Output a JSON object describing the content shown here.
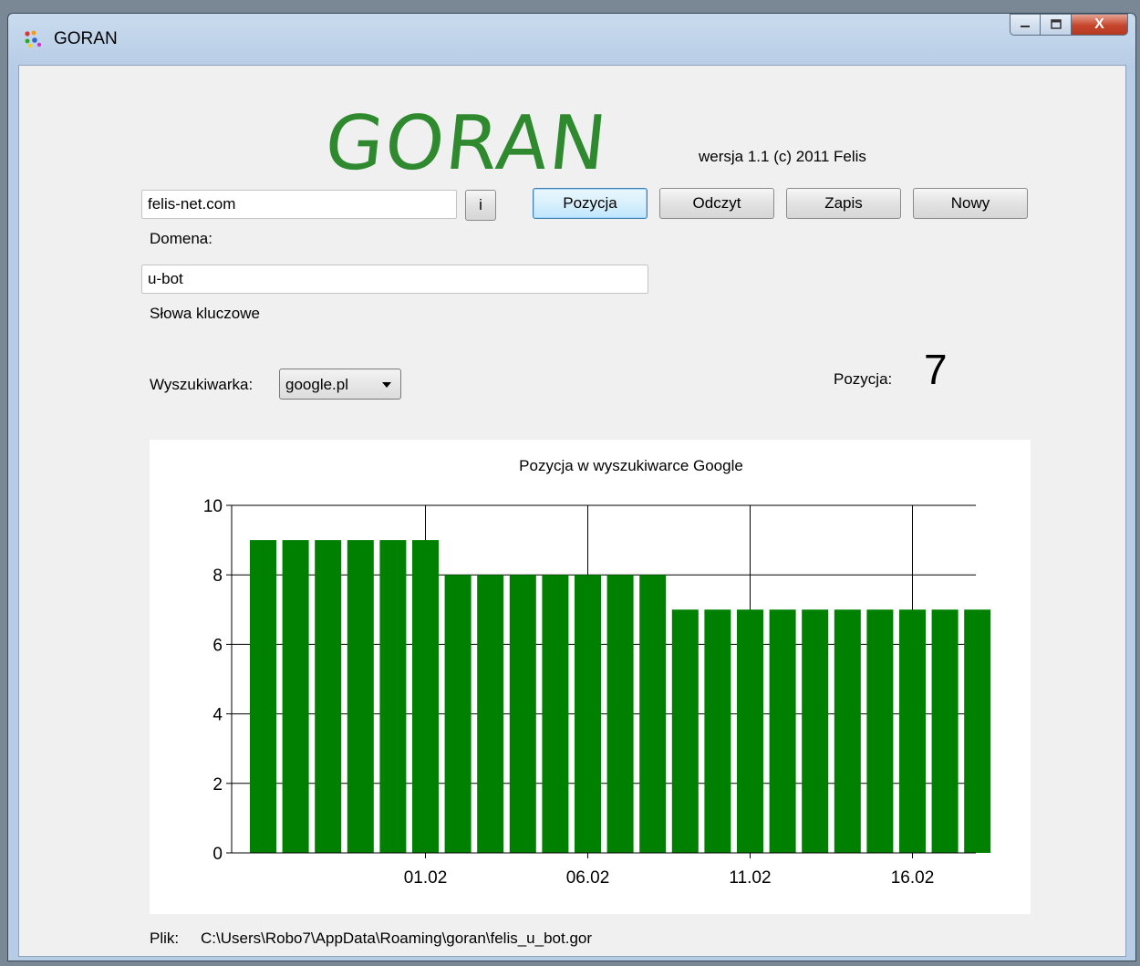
{
  "window": {
    "title": "GORAN",
    "buttons": {
      "minimize": "–",
      "maximize": "□",
      "close": "X"
    }
  },
  "header": {
    "logo_text": "GORAN",
    "version": "wersja 1.1   (c) 2011 Felis"
  },
  "form": {
    "domain_value": "felis-net.com",
    "info_button": "i",
    "domain_label": "Domena:",
    "keywords_value": "u-bot",
    "keywords_label": "Słowa kluczowe",
    "engine_label": "Wyszukiwarka:",
    "engine_selected": "google.pl",
    "position_label": "Pozycja:",
    "position_value": "7"
  },
  "toolbar": {
    "pozycja": "Pozycja",
    "odczyt": "Odczyt",
    "zapis": "Zapis",
    "nowy": "Nowy"
  },
  "footer": {
    "file_label": "Plik:",
    "file_path": "C:\\Users\\Robo7\\AppData\\Roaming\\goran\\felis_u_bot.gor"
  },
  "colors": {
    "bar": "#008000",
    "logo": "#2f8a2f"
  },
  "chart_data": {
    "type": "bar",
    "title": "Pozycja w wyszukiwarce Google",
    "x": [
      "27.01",
      "28.01",
      "29.01",
      "30.01",
      "31.01",
      "01.02",
      "02.02",
      "03.02",
      "04.02",
      "05.02",
      "06.02",
      "07.02",
      "08.02",
      "09.02",
      "10.02",
      "11.02",
      "12.02",
      "13.02",
      "14.02",
      "15.02",
      "16.02",
      "17.02",
      "18.02"
    ],
    "values": [
      9,
      9,
      9,
      9,
      9,
      9,
      8,
      8,
      8,
      8,
      8,
      8,
      8,
      7,
      7,
      7,
      7,
      7,
      7,
      7,
      7,
      7,
      7
    ],
    "x_ticks": [
      "01.02",
      "06.02",
      "11.02",
      "16.02"
    ],
    "y_ticks": [
      0,
      2,
      4,
      6,
      8,
      10
    ],
    "ylim": [
      0,
      10
    ],
    "grid": true,
    "xlabel": "",
    "ylabel": ""
  }
}
